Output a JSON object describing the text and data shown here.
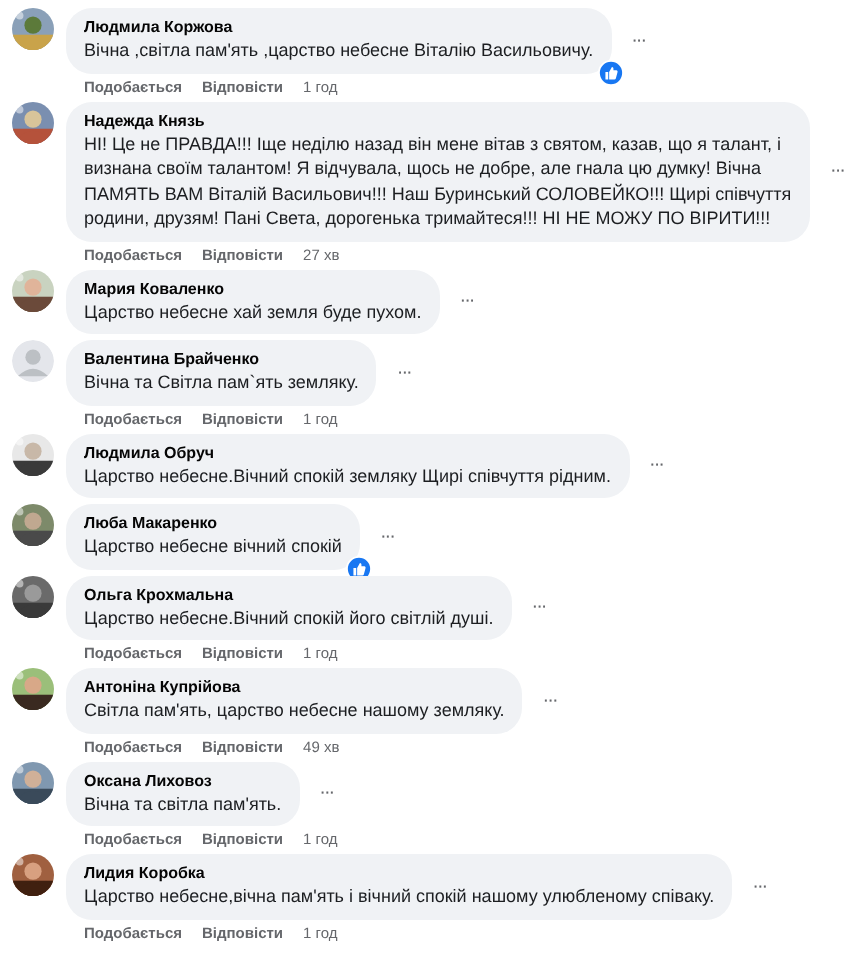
{
  "comments": [
    {
      "name": "Людмила Коржова",
      "text": "Вічна ,світла пам'ять ,царство небесне Віталію Васильовичу.",
      "reaction": true,
      "actions": {
        "like": "Подобається",
        "reply": "Відповісти",
        "time": "1 год"
      },
      "more": "···"
    },
    {
      "name": "Надежда Князь",
      "text": "НІ! Це не ПРАВДА!!! Іще неділю назад він мене вітав з святом, казав, що я талант, і визнана своїм талантом! Я відчувала, щось не добре, але гнала цю думку! Вічна ПАМЯТЬ ВАМ Віталій Васильович!!! Наш Буринський СОЛОВЕЙКО!!! Щирі співчуття родини, друзям! Пані Света, дорогенька тримайтеся!!! НІ НЕ МОЖУ ПО ВІРИТИ!!!",
      "reaction": false,
      "actions": {
        "like": "Подобається",
        "reply": "Відповісти",
        "time": "27 хв"
      },
      "more": "···"
    },
    {
      "name": "Мария Коваленко",
      "text": "Царство небесне хай земля буде пухом.",
      "reaction": false,
      "more": "···"
    },
    {
      "avatar": {
        "kind": "silhouette"
      },
      "name": "Валентина Брайченко",
      "text": "Вічна та Світла пам`ять земляку.",
      "reaction": false,
      "actions": {
        "like": "Подобається",
        "reply": "Відповісти",
        "time": "1 год"
      },
      "more": "···"
    },
    {
      "name": "Людмила Обруч",
      "text": "Царство небесне.Вічний спокій земляку Щирі співчуття рідним.",
      "reaction": false,
      "more": "···"
    },
    {
      "name": "Люба Макаренко",
      "text": "Царство небесне вічний спокій",
      "reaction": true,
      "more": "···"
    },
    {
      "name": "Ольга Крохмальна",
      "text": "Царство небесне.Вічний спокій його світлій душі.",
      "reaction": false,
      "actions": {
        "like": "Подобається",
        "reply": "Відповісти",
        "time": "1 год"
      },
      "more": "···"
    },
    {
      "name": "Антоніна Купрійова",
      "text": "Світла пам'ять, царство небесне нашому земляку.",
      "reaction": false,
      "actions": {
        "like": "Подобається",
        "reply": "Відповісти",
        "time": "49 хв"
      },
      "more": "···"
    },
    {
      "name": "Оксана Лиховоз",
      "text": "Вічна та світла пам'ять.",
      "reaction": false,
      "actions": {
        "like": "Подобається",
        "reply": "Відповісти",
        "time": "1 год"
      },
      "more": "···"
    },
    {
      "name": "Лидия Коробка",
      "text": "Царство небесне,вічна пам'ять і вічний спокій нашому улюбленому співаку.",
      "reaction": false,
      "actions": {
        "like": "Подобається",
        "reply": "Відповісти",
        "time": "1 год"
      },
      "more": "···"
    }
  ]
}
